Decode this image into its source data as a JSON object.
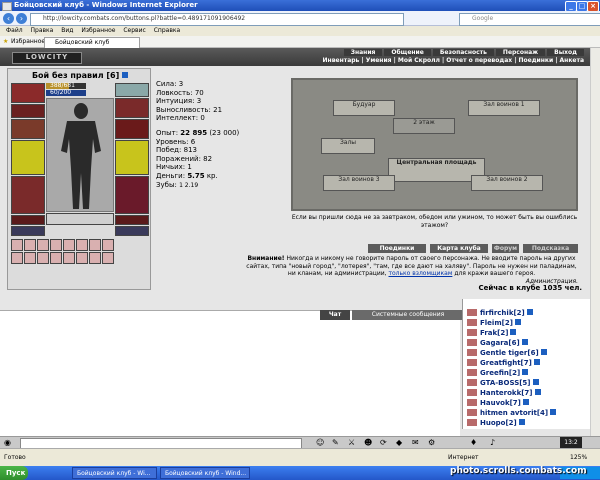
{
  "window": {
    "title": "Бойцовский клуб - Windows Internet Explorer"
  },
  "addressbar": {
    "url": "http://lowcity.combats.com/buttons.pl?battle=0.489171091906492",
    "search_placeholder": "Google"
  },
  "menu": [
    "Файл",
    "Правка",
    "Вид",
    "Избранное",
    "Сервис",
    "Справка"
  ],
  "favorites": {
    "label": "Избранное",
    "tab": "Бойцовский клуб"
  },
  "site": {
    "logo": "LOWCITY",
    "nav_top": [
      "Знания",
      "Общение",
      "Безопасность",
      "Персонаж",
      "Выход"
    ],
    "nav_sub": "Инвентарь | Умения | Мой Скролл | Отчет о переводах | Поединки | Анкета"
  },
  "character": {
    "title": "Бой без правил",
    "level": "[6]",
    "hp": "388/681",
    "mana": "60/200",
    "stats": [
      {
        "label": "Сила:",
        "value": "3"
      },
      {
        "label": "Ловкость:",
        "value": "70"
      },
      {
        "label": "Интуиция:",
        "value": "3"
      },
      {
        "label": "Выносливость:",
        "value": "21"
      },
      {
        "label": "Интеллект:",
        "value": "0"
      }
    ],
    "exp": {
      "label": "Опыт:",
      "value": "22 895",
      "next": "(23 000)"
    },
    "info": [
      {
        "label": "Уровень:",
        "value": "6"
      },
      {
        "label": "Побед:",
        "value": "813"
      },
      {
        "label": "Поражений:",
        "value": "82"
      },
      {
        "label": "Ничьих:",
        "value": "1"
      }
    ],
    "money": {
      "label": "Деньги:",
      "value": "5.75",
      "unit": "кр."
    },
    "teeth": {
      "label": "Зубы:",
      "value": "1 2.19"
    }
  },
  "map": {
    "rooms": [
      "Будуар",
      "Зал воинов 1",
      "2 этаж",
      "Залы",
      "Центральная площадь",
      "Зал воинов 2",
      "Зал воинов 3"
    ]
  },
  "map_text": "Если вы пришли сюда не за завтраком, обедом или ужином, то может быть вы ошиблись этажом?",
  "buttons": [
    "Поединки",
    "Карта клуба",
    "Форум",
    "Подсказка"
  ],
  "notice": {
    "bold": "Внимание!",
    "text": "Никогда и никому не говорите пароль от своего персонажа. Не вводите пароль на других сайтах, типа \"новый город\", \"лотерея\", \"там, где все дают на халяву\". Пароль не нужен ни паладинам, ни кланам, ни администрации,",
    "link": "только взломщикам",
    "tail": "для кражи вашего героя.",
    "sign": "Администрация."
  },
  "online": "Сейчас в клубе 1035 чел.",
  "chat": {
    "tab_chat": "Чат",
    "tab_system": "Системные сообщения"
  },
  "users": [
    {
      "name": "firfirchik",
      "level": "[2]"
    },
    {
      "name": "Fleim",
      "level": "[2]"
    },
    {
      "name": "Frak",
      "level": "[2]"
    },
    {
      "name": "Gagara",
      "level": "[6]"
    },
    {
      "name": "Gentle tiger",
      "level": "[6]"
    },
    {
      "name": "Greatfight",
      "level": "[7]"
    },
    {
      "name": "Greefin",
      "level": "[2]"
    },
    {
      "name": "GTA-BOSS",
      "level": "[5]"
    },
    {
      "name": "Hanterokk",
      "level": "[7]"
    },
    {
      "name": "Hauvok",
      "level": "[7]"
    },
    {
      "name": "hitmen avtorit",
      "level": "[4]"
    },
    {
      "name": "Нuopo",
      "level": "[2]"
    }
  ],
  "clock": "13:2",
  "status": {
    "left": "Готово",
    "zone": "Интернет",
    "zoom": "125%"
  },
  "taskbar": {
    "start": "Пуск",
    "tasks": [
      "Бойцовский клуб - Wi...",
      "Бойцовский клуб - Wind..."
    ],
    "tray_time": "13:2"
  },
  "watermark": "photo.scrolls.combats.com"
}
